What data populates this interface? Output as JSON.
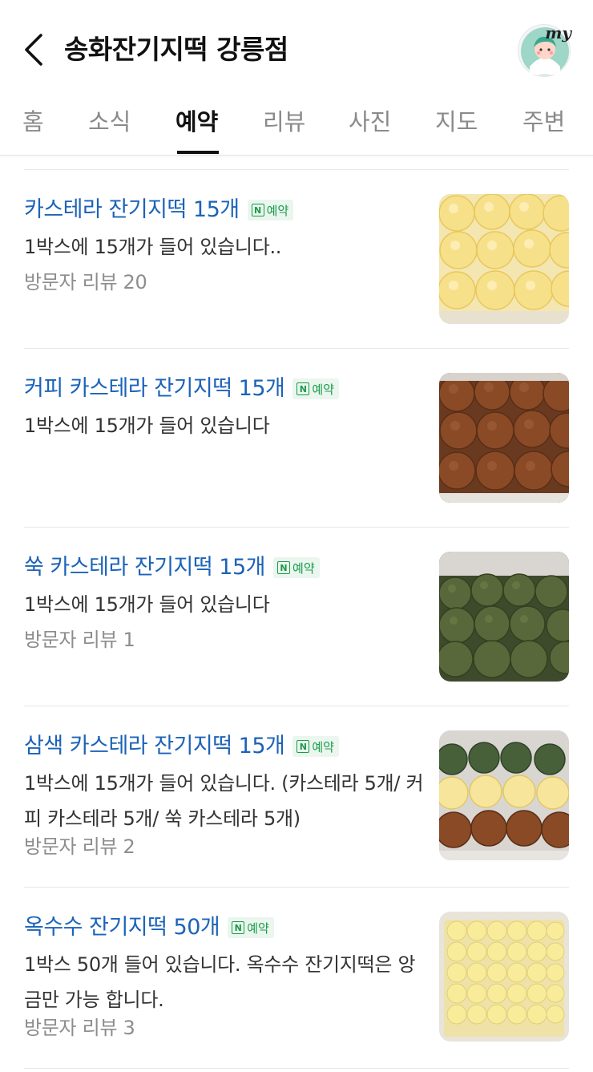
{
  "header": {
    "title": "송화잔기지떡 강릉점",
    "back_icon": "chevron-left-icon",
    "profile_label": "my"
  },
  "tabs": [
    {
      "label": "홈",
      "active": false
    },
    {
      "label": "소식",
      "active": false
    },
    {
      "label": "예약",
      "active": true
    },
    {
      "label": "리뷰",
      "active": false
    },
    {
      "label": "사진",
      "active": false
    },
    {
      "label": "지도",
      "active": false
    },
    {
      "label": "주변",
      "active": false
    }
  ],
  "colors": {
    "link_blue": "#1c63b8",
    "naver_green": "#1a9b4a",
    "badge_bg": "#eaf6ee",
    "gray_text": "#8d8d8d"
  },
  "booking_badge": {
    "icon_letter": "N",
    "label": "예약"
  },
  "items": [
    {
      "name": "카스테라 잔기지떡 15개",
      "description": "1박스에 15개가 들어 있습니다..",
      "review": "방문자 리뷰 20",
      "thumbnail": "yellow-castella-rice-cakes"
    },
    {
      "name": "커피 카스테라 잔기지떡 15개",
      "description": "1박스에 15개가 들어 있습니다",
      "review": null,
      "thumbnail": "coffee-castella-rice-cakes"
    },
    {
      "name": "쑥 카스테라 잔기지떡 15개",
      "description": "1박스에 15개가 들어 있습니다",
      "review": "방문자 리뷰 1",
      "thumbnail": "mugwort-castella-rice-cakes"
    },
    {
      "name": "삼색 카스테라 잔기지떡 15개",
      "description": "1박스에 15개가 들어 있습니다. (카스테라 5개/ 커피 카스테라 5개/ 쑥 카스테라 5개)",
      "review": "방문자 리뷰 2",
      "thumbnail": "tricolor-castella-rice-cakes"
    },
    {
      "name": "옥수수 잔기지떡 50개",
      "description": "1박스 50개 들어 있습니다. 옥수수 잔기지떡은 앙금만 가능 합니다.",
      "review": "방문자 리뷰 3",
      "thumbnail": "corn-rice-cakes"
    }
  ]
}
